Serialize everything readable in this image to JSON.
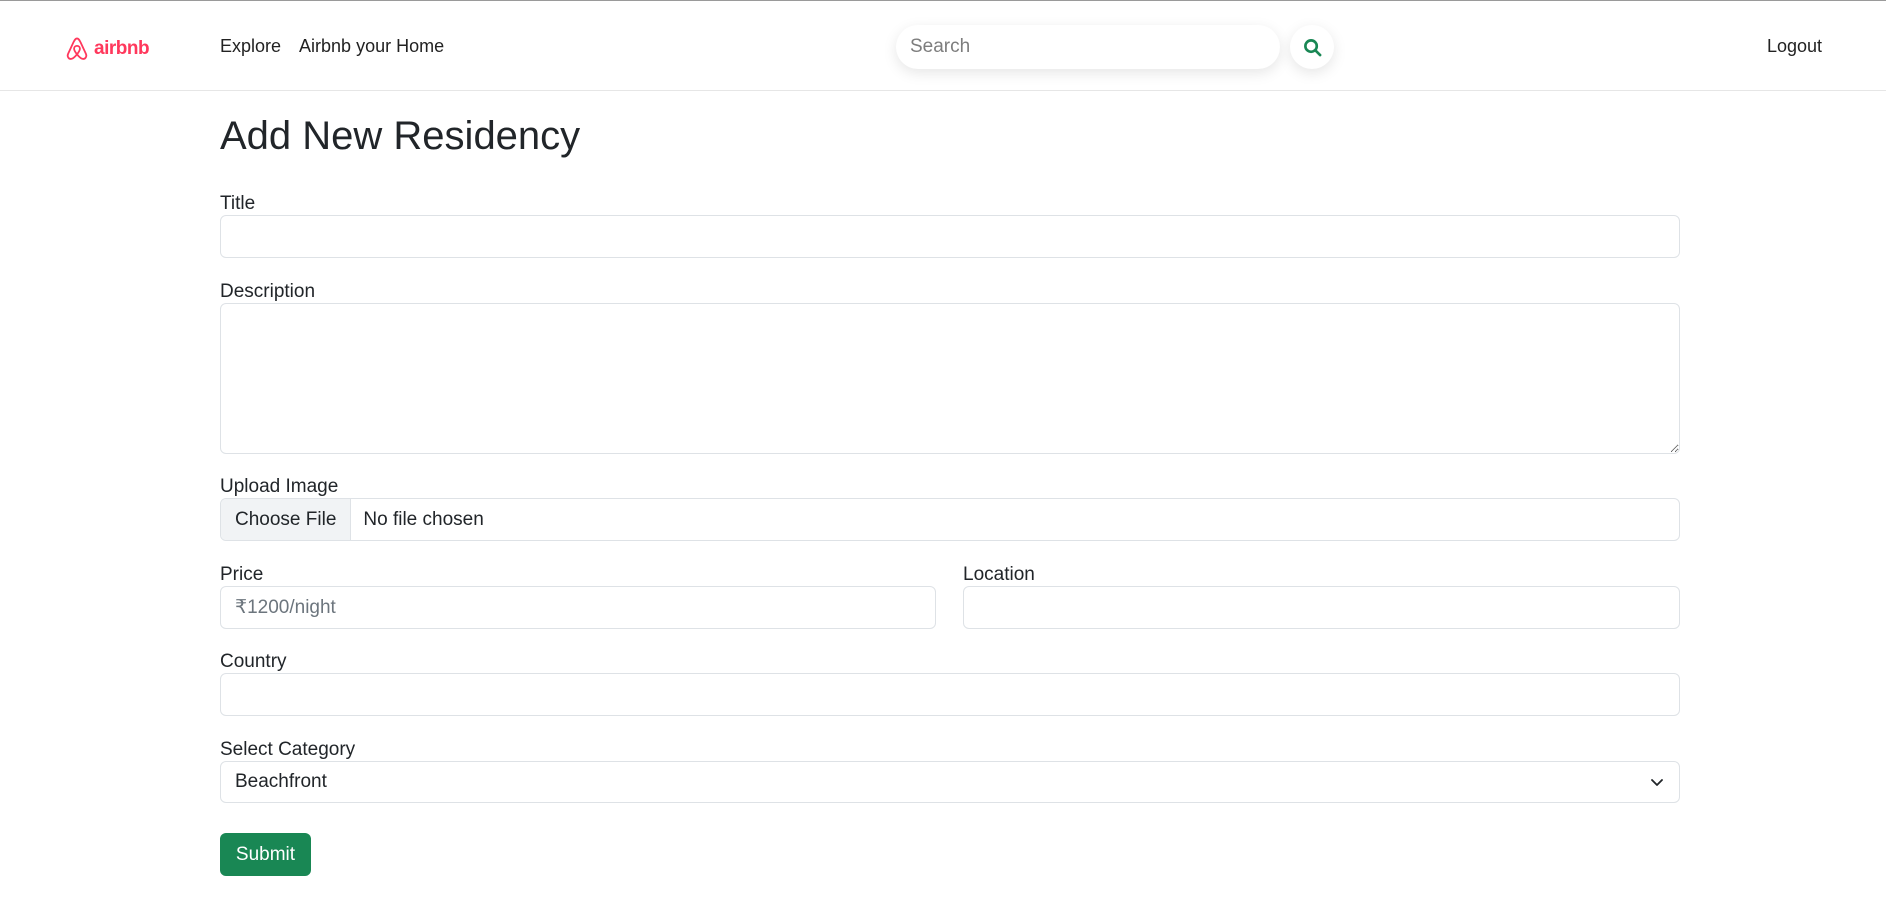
{
  "navbar": {
    "brand": "airbnb",
    "links": [
      "Explore",
      "Airbnb your Home"
    ],
    "search_placeholder": "Search",
    "logout_label": "Logout",
    "brand_color": "#ff385c",
    "search_icon_color": "#198754"
  },
  "form": {
    "heading": "Add New Residency",
    "title_label": "Title",
    "description_label": "Description",
    "upload_label": "Upload Image",
    "choose_file_label": "Choose File",
    "file_status": "No file chosen",
    "price_label": "Price",
    "price_placeholder": "₹1200/night",
    "location_label": "Location",
    "country_label": "Country",
    "category_label": "Select Category",
    "category_selected": "Beachfront",
    "submit_label": "Submit",
    "submit_color": "#198754"
  }
}
